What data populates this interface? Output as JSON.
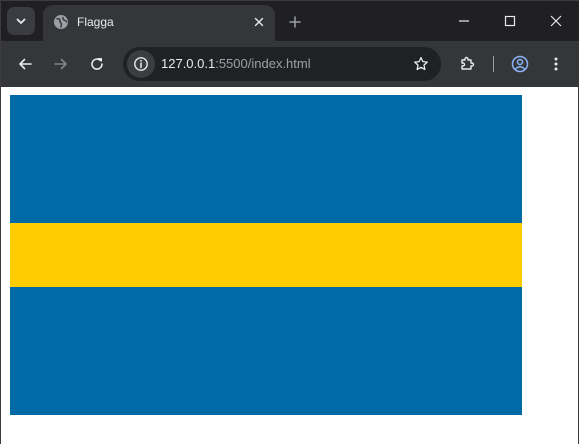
{
  "tab": {
    "title": "Flagga"
  },
  "address_bar": {
    "host": "127.0.0.1",
    "rest": ":5500/index.html"
  },
  "flag": {
    "blue": "#006aa7",
    "yellow": "#fecc00"
  },
  "icons": {
    "tab_search": "chevron-down-icon",
    "favicon": "globe-icon",
    "tab_close": "close-icon",
    "new_tab": "plus-icon",
    "minimize": "minimize-icon",
    "maximize": "maximize-icon",
    "window_close": "close-icon",
    "back": "arrow-left-icon",
    "forward": "arrow-right-icon",
    "reload": "reload-icon",
    "site_info": "info-icon",
    "bookmark": "star-icon",
    "extensions": "puzzle-icon",
    "profile": "profile-icon",
    "menu": "kebab-menu-icon"
  }
}
